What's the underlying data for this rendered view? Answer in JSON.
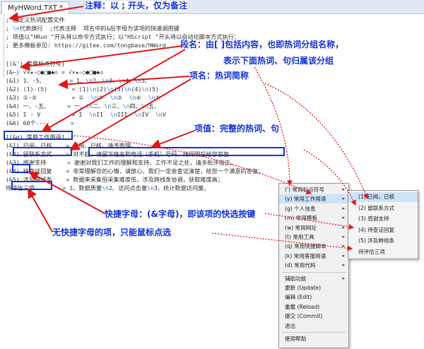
{
  "window": {
    "tab_title": "MyHWord.TXT *"
  },
  "editor_lines": [
    "; 自定义热词配置文件",
    "; \\n代表换行  ;代表注释  项名中的&后字母为该项的快速调用键",
    "; 项值以\"HRun \"开头将以命令方式执行；以\"HScript \"开头将以自动化脚本方式执行：",
    "; 更多模板参见: https://gitee.com/tongbase/HWord",
    "",
    "[(&') 常用标点符号]",
    "(&~) √×★☆○●□■◆◇ = √×★☆○●□■◆◇",
    "(&1) 1、-5、       = 1、\\n2、\\n3、\\n4、\\n5、",
    "(&2) (1)-(5)       = (1)\\n(2)\\n(3)\\n(4)\\n(5)",
    "(&3) ①-⑤          = ①  \\n②  \\n③  \\n④  \\n⑤",
    "(&4) 一、-五、     = 一、\\n二、\\n三、\\n四、\\n五、",
    "(&5) I - V         = I  \\nII  \\nIII  \\nIV  \\nV",
    "(&6) 60个----      =",
    "",
    "[(&g) 常用工作用语]",
    "(&1) 已阅，已核    = 已阅，已核，请予审理。",
    "(&2) 留联系方式    = 对不起，请留下姓名和电话（手机）号码，待问明后给您答复",
    "(&3) 感谢支持      = 谢谢对我们工作的理解和支持，工作不足之处，请多批评指正。",
    "(&4) 待查证回复    = 非常理解您的心情，请放心，我们一定会查证清楚，给您一个满意的答复；",
    "(&5) 涉及跨线条    = 数据来采集但采集难度低，涉及跨线条协调，获取难度高；",
    "待评估三项        = 1、数据质量\\n2、访问点击量\\n3、统计数据访问量。"
  ],
  "annotations": {
    "comment": "注释：以 ; 开头，仅为备注",
    "section": "段名：由[ ]包括内容，也即热词分组名称，",
    "section2": "表示下面热词、句归属该分组",
    "item_name": "项名：热词简称",
    "item_value": "项值：完整的热词、句",
    "shortcut": "快捷字母：(&字母)，即该项的快选按键",
    "no_shortcut": "无快捷字母的项，只能鼠标点选"
  },
  "context_menu": {
    "items": [
      {
        "label": "(') 常用标点符号",
        "has_submenu": true
      },
      {
        "label": "(y) 常用工作用语",
        "has_submenu": true
      },
      {
        "label": "(g) 个人信息",
        "has_submenu": true
      },
      {
        "label": "(m) 常用模板",
        "has_submenu": true
      },
      {
        "label": "(w) 常用网址",
        "has_submenu": true
      },
      {
        "label": "(t) 常用工具",
        "has_submenu": true
      },
      {
        "label": "(q) 常用快捷脚本",
        "has_submenu": true
      },
      {
        "label": "(k) 常用客服用语",
        "has_submenu": true
      },
      {
        "label": "(d) 常用代码",
        "has_submenu": true
      },
      {
        "label": "辅助功能",
        "has_submenu": true
      },
      {
        "label": "更新 (Update)",
        "has_submenu": false
      },
      {
        "label": "编辑 (Edit)",
        "has_submenu": false
      },
      {
        "label": "重载 (Reload)",
        "has_submenu": false
      },
      {
        "label": "提交 (Commit)",
        "has_submenu": false
      },
      {
        "label": "退出",
        "has_submenu": false
      },
      {
        "label": "使用帮助",
        "has_submenu": false
      }
    ],
    "arrow_glyph": "▸"
  },
  "submenu": {
    "items": [
      "(1) 已阅，已核",
      "(2) 留联系方式",
      "(3) 感谢支持",
      "(4) 待查证回复",
      "(5) 涉及跨线条",
      "待评估三项"
    ]
  },
  "colors": {
    "annotation_blue": "#1232d6",
    "arrow_red": "#e01818",
    "highlight": "#cde3f7"
  }
}
